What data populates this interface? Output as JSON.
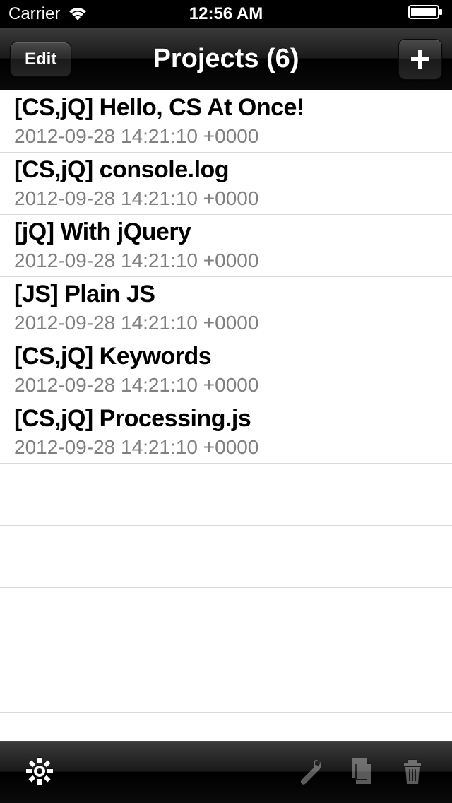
{
  "status": {
    "carrier": "Carrier",
    "time": "12:56 AM"
  },
  "nav": {
    "edit_label": "Edit",
    "title": "Projects (6)",
    "add_label": "+"
  },
  "projects": [
    {
      "title": "[CS,jQ] Hello, CS At Once!",
      "date": "2012-09-28 14:21:10 +0000"
    },
    {
      "title": "[CS,jQ] console.log",
      "date": "2012-09-28 14:21:10 +0000"
    },
    {
      "title": "[jQ] With jQuery",
      "date": "2012-09-28 14:21:10 +0000"
    },
    {
      "title": "[JS] Plain JS",
      "date": "2012-09-28 14:21:10 +0000"
    },
    {
      "title": "[CS,jQ] Keywords",
      "date": "2012-09-28 14:21:10 +0000"
    },
    {
      "title": "[CS,jQ] Processing.js",
      "date": "2012-09-28 14:21:10 +0000"
    }
  ],
  "toolbar": {
    "icons": {
      "settings": "gear-icon",
      "wrench": "wrench-icon",
      "copy": "copy-icon",
      "trash": "trash-icon"
    }
  }
}
